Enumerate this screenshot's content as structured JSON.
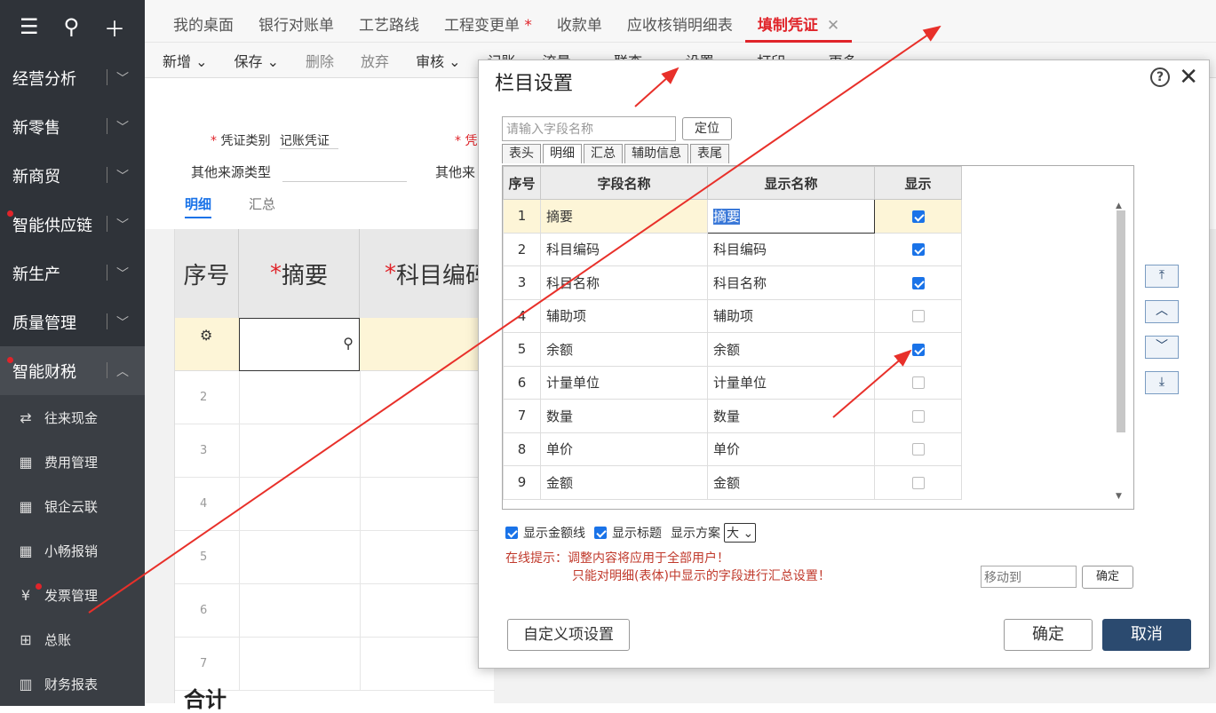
{
  "sidebar": {
    "items": [
      {
        "label": "经营分析",
        "dot": false
      },
      {
        "label": "新零售",
        "dot": false
      },
      {
        "label": "新商贸",
        "dot": false
      },
      {
        "label": "智能供应链",
        "dot": true
      },
      {
        "label": "新生产",
        "dot": false
      },
      {
        "label": "质量管理",
        "dot": false
      },
      {
        "label": "智能财税",
        "dot": true
      }
    ],
    "subitems": [
      {
        "label": "往来现金",
        "icon": "⇄"
      },
      {
        "label": "费用管理",
        "icon": "▦"
      },
      {
        "label": "银企云联",
        "icon": "▦"
      },
      {
        "label": "小畅报销",
        "icon": "▦"
      },
      {
        "label": "发票管理",
        "icon": "¥"
      },
      {
        "label": "总账",
        "icon": "⊞"
      },
      {
        "label": "财务报表",
        "icon": "▥"
      }
    ]
  },
  "tabs": [
    "我的桌面",
    "银行对账单",
    "工艺路线",
    "工程变更单",
    "收款单",
    "应收核销明细表",
    "填制凭证"
  ],
  "toolbar": [
    "新增",
    "保存",
    "删除",
    "放弃",
    "审核",
    "记账",
    "流量",
    "联查",
    "设置",
    "打印",
    "更多"
  ],
  "voucher": {
    "type_label": "凭证类别",
    "type_value": "记账凭证",
    "source_label": "其他来源类型",
    "source_label2": "其他来",
    "tab_detail": "明细",
    "tab_summary": "汇总",
    "col_seq": "序号",
    "col_summary": "摘要",
    "col_account": "科目编码",
    "total": "合计",
    "rows": [
      "2",
      "3",
      "4",
      "5",
      "6",
      "7"
    ]
  },
  "dialog": {
    "title": "栏目设置",
    "search_placeholder": "请输入字段名称",
    "locate": "定位",
    "subtabs": [
      "表头",
      "明细",
      "汇总",
      "辅助信息",
      "表尾"
    ],
    "active_subtab": 1,
    "headers": [
      "序号",
      "字段名称",
      "显示名称",
      "显示"
    ],
    "rows": [
      {
        "seq": "1",
        "field": "摘要",
        "display": "摘要",
        "shown": true
      },
      {
        "seq": "2",
        "field": "科目编码",
        "display": "科目编码",
        "shown": true
      },
      {
        "seq": "3",
        "field": "科目名称",
        "display": "科目名称",
        "shown": true
      },
      {
        "seq": "4",
        "field": "辅助项",
        "display": "辅助项",
        "shown": false
      },
      {
        "seq": "5",
        "field": "余额",
        "display": "余额",
        "shown": true
      },
      {
        "seq": "6",
        "field": "计量单位",
        "display": "计量单位",
        "shown": false
      },
      {
        "seq": "7",
        "field": "数量",
        "display": "数量",
        "shown": false
      },
      {
        "seq": "8",
        "field": "单价",
        "display": "单价",
        "shown": false
      },
      {
        "seq": "9",
        "field": "金额",
        "display": "金额",
        "shown": false
      }
    ],
    "opt_amount_line": "显示金额线",
    "opt_show_title": "显示标题",
    "opt_scheme": "显示方案",
    "scheme_value": "大",
    "hint_prefix": "在线提示：",
    "hint1": "调整内容将应用于全部用户！",
    "hint2": "只能对明细(表体)中显示的字段进行汇总设置！",
    "moveto_placeholder": "移动到",
    "moveto_ok": "确定",
    "custom": "自定义项设置",
    "ok": "确定",
    "cancel": "取消"
  },
  "colors": {
    "accent": "#e0242a",
    "sidebar": "#2f3339",
    "primary": "#2b4a6f",
    "check": "#1a73e8"
  }
}
